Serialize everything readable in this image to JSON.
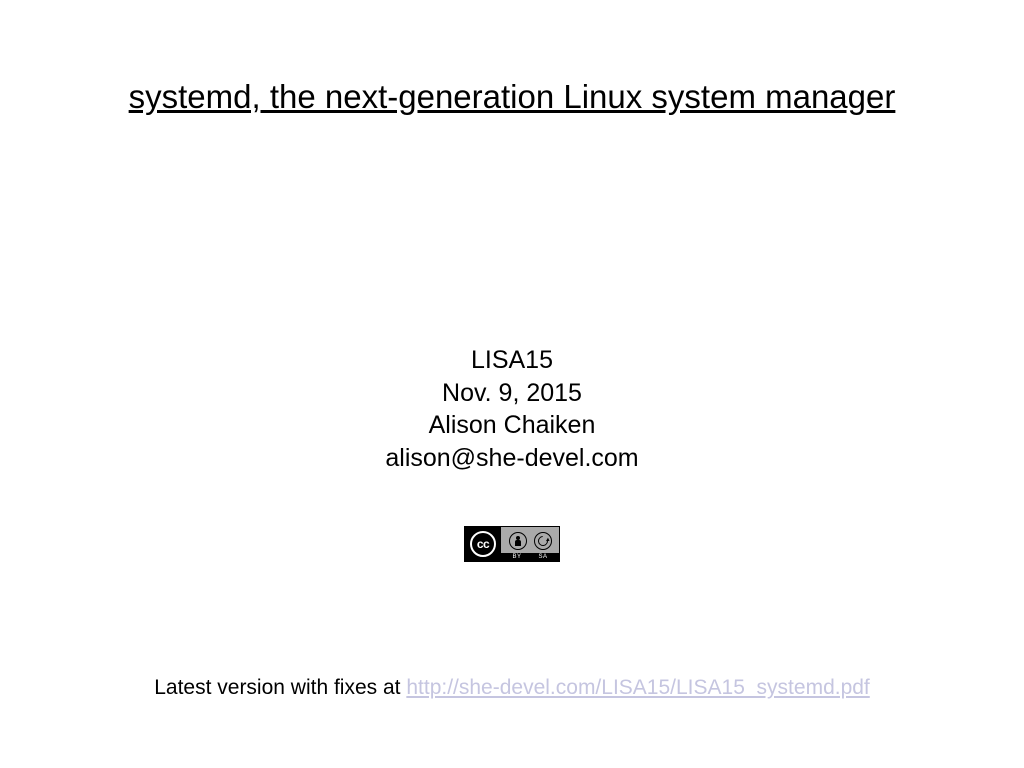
{
  "title": "systemd, the next-generation Linux system manager",
  "meta": {
    "conference": "LISA15",
    "date": "Nov. 9, 2015",
    "author": "Alison Chaiken",
    "email": "alison@she-devel.com"
  },
  "license": {
    "cc_label": "cc",
    "by_label": "BY",
    "sa_label": "SA"
  },
  "footer": {
    "prefix": "Latest version with fixes at ",
    "link_text": "http://she-devel.com/LISA15/LISA15_systemd.pdf"
  }
}
